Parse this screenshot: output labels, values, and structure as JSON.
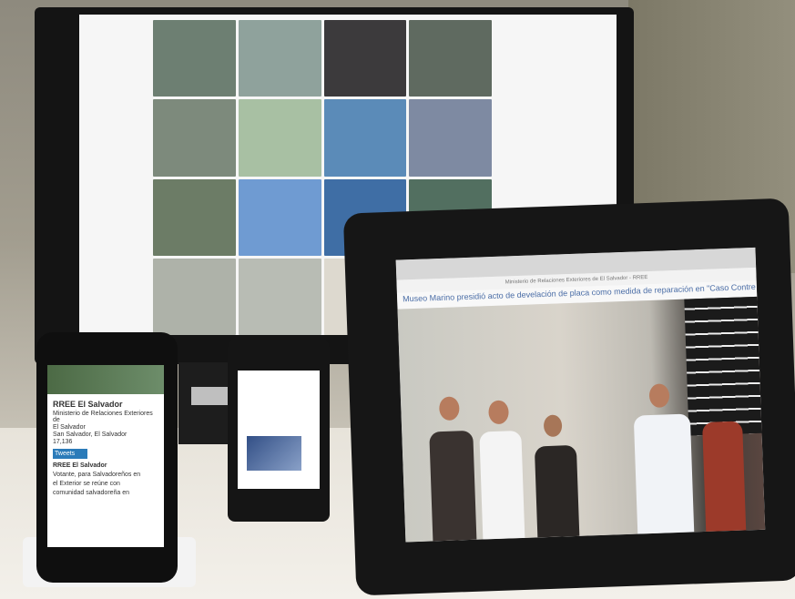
{
  "phone_left": {
    "account_name": "RREE El Salvador",
    "bio_lines": [
      "Ministerio de Relaciones Exteriores de",
      "El Salvador"
    ],
    "location": "San Salvador, El Salvador",
    "stat": "17,136",
    "tab": "Tweets",
    "tweet_author": "RREE El Salvador",
    "tweet_lines": [
      "Votante, para Salvadoreños en",
      "el Exterior se reúne con",
      "comunidad salvadoreña en"
    ]
  },
  "tablet": {
    "page_header": "Ministerio de Relaciones Exteriores de El Salvador - RREE",
    "headline": "Museo Marino presidió acto de develación de placa como medida de reparación en \"Caso Contre"
  },
  "colors": {
    "accent_blue": "#2b7bb9",
    "headline_blue": "#4a6da6"
  },
  "monitor_tiles": [
    "#6d7f72",
    "#8fa29c",
    "#3c3a3c",
    "#5f6a60",
    "#7d8a7c",
    "#a8c0a3",
    "#5b8bb8",
    "#7e8aa2",
    "#6c7c66",
    "#6f9bd2",
    "#3f6ea5",
    "#526f60",
    "#aeb2a9",
    "#b8bcb4",
    "#ddd9cf",
    "#e7e5df"
  ]
}
